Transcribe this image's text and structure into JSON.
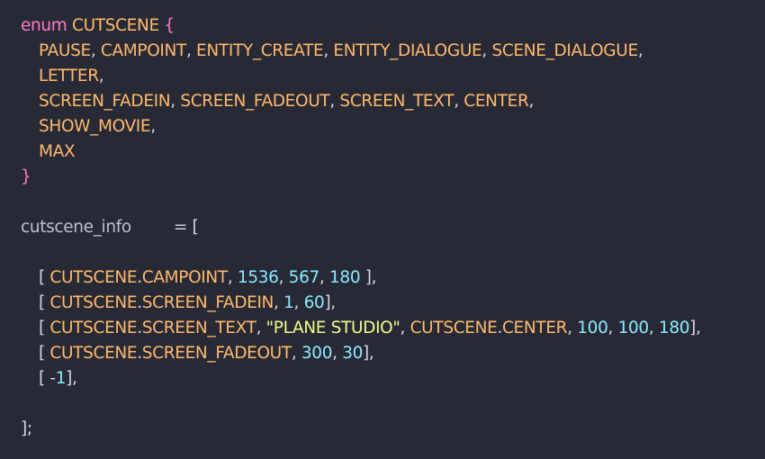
{
  "editor": {
    "enum_keyword": "enum",
    "enum_name": "CUTSCENE",
    "open_brace": "{",
    "close_brace": "}",
    "members": [
      "PAUSE",
      "CAMPOINT",
      "ENTITY_CREATE",
      "ENTITY_DIALOGUE",
      "SCENE_DIALOGUE",
      "LETTER",
      "SCREEN_FADEIN",
      "SCREEN_FADEOUT",
      "SCREEN_TEXT",
      "CENTER",
      "SHOW_MOVIE",
      "MAX"
    ],
    "var_name": "cutscene_info",
    "assign": "= [",
    "rows": [
      {
        "prefix": "CUTSCENE",
        "member": "CAMPOINT",
        "args": [
          "1536",
          "567",
          "180"
        ]
      },
      {
        "prefix": "CUTSCENE",
        "member": "SCREEN_FADEIN",
        "args": [
          "1",
          "60"
        ]
      },
      {
        "prefix": "CUTSCENE",
        "member": "SCREEN_TEXT",
        "string": "\"PLANE STUDIO\"",
        "center_prefix": "CUTSCENE",
        "center_member": "CENTER",
        "args": [
          "100",
          "100",
          "180"
        ]
      },
      {
        "prefix": "CUTSCENE",
        "member": "SCREEN_FADEOUT",
        "args": [
          "300",
          "30"
        ]
      },
      {
        "neg_sign": "-",
        "neg_value": "1"
      }
    ],
    "end": "];"
  },
  "colors": {
    "background": "#272a35",
    "keyword": "#ff79c6",
    "enum_member": "#ffb86c",
    "number": "#8be9fd",
    "string": "#f1fa8c",
    "plain": "#b8b2c8"
  }
}
